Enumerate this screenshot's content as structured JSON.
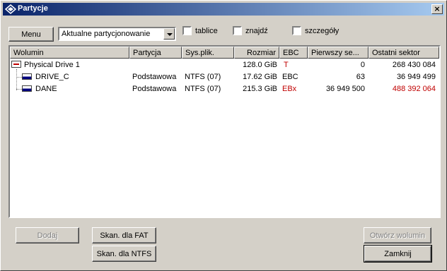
{
  "window": {
    "title": "Partycje",
    "close_label": "×"
  },
  "toolbar": {
    "menu_label": "Menu",
    "view_select": "Aktualne partycjonowanie",
    "check_tables": "tablice",
    "check_find": "znajdź",
    "check_details": "szczegóły"
  },
  "columns": [
    "Wolumin",
    "Partycja",
    "Sys.plik.",
    "Rozmiar",
    "EBC",
    "Pierwszy se...",
    "Ostatni sektor"
  ],
  "rows": [
    {
      "name": "Physical Drive 1",
      "partition": "",
      "fs": "",
      "size": "128.0 GiB",
      "ebc": "T",
      "first": "0",
      "last": "268 430 084"
    },
    {
      "name": "DRIVE_C",
      "partition": "Podstawowa",
      "fs": "NTFS (07)",
      "size": "17.62 GiB",
      "ebc": "EBC",
      "first": "63",
      "last": "36 949 499"
    },
    {
      "name": "DANE",
      "partition": "Podstawowa",
      "fs": "NTFS (07)",
      "size": "215.3 GiB",
      "ebc": "EBx",
      "first": "36 949 500",
      "last": "488 392 064"
    }
  ],
  "buttons": {
    "add": "Dodaj",
    "scan_fat": "Skan. dla FAT",
    "scan_ntfs": "Skan. dla NTFS",
    "open_volume": "Otwórz wolumin",
    "close": "Zamknij"
  },
  "colors": {
    "title_start": "#0a246a",
    "title_end": "#a6caf0",
    "warning_red": "#c00000"
  }
}
